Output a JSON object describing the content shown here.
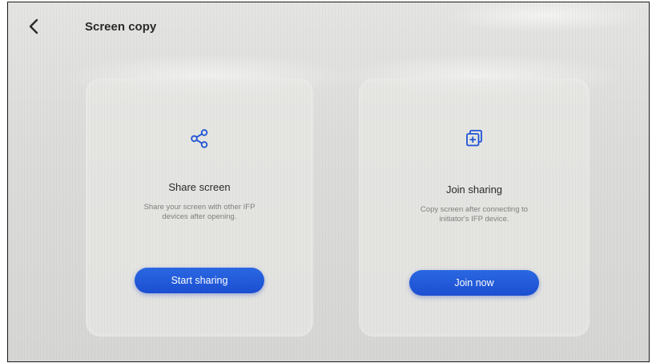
{
  "header": {
    "title": "Screen copy",
    "back_icon": "chevron-left-icon"
  },
  "cards": [
    {
      "icon": "share-icon",
      "title": "Share screen",
      "description_line1": "Share your screen with other IFP",
      "description_line2": "devices after opening.",
      "button_label": "Start sharing"
    },
    {
      "icon": "copy-add-icon",
      "title": "Join sharing",
      "description_line1": "Copy screen after connecting to",
      "description_line2": "initiator's IFP device.",
      "button_label": "Join now"
    }
  ],
  "colors": {
    "accent": "#1f55d6",
    "icon": "#1f55d6",
    "background": "#dcdcda"
  }
}
